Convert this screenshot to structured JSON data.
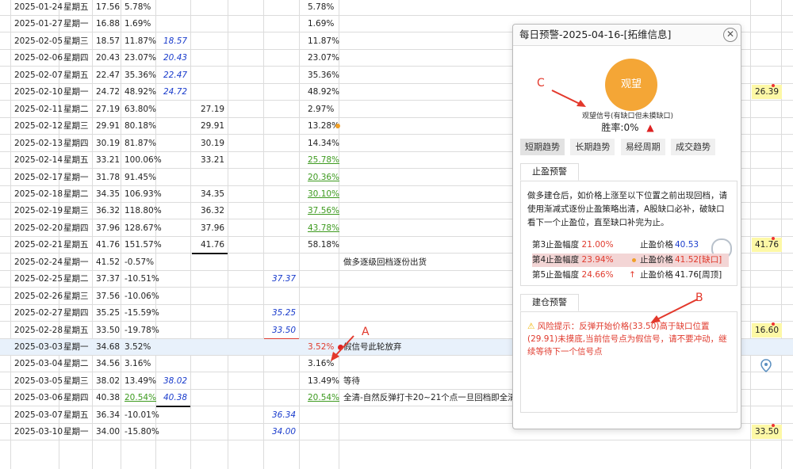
{
  "table": {
    "rows": [
      {
        "date": "2025-01-24",
        "weekday": "星期五",
        "price": "17.56",
        "pct": "5.78%",
        "pct_style": "",
        "blue": "",
        "blue_underline": false,
        "price2": "",
        "price2_underline": false,
        "blue2": "",
        "blue2_underline": false,
        "r": "5.78%",
        "r_style": "",
        "r_dot": "",
        "note": "",
        "yellow": "",
        "highlight": false
      },
      {
        "date": "2025-01-27",
        "weekday": "星期一",
        "price": "16.88",
        "pct": "1.69%",
        "pct_style": "",
        "blue": "",
        "blue_underline": false,
        "price2": "",
        "price2_underline": false,
        "blue2": "",
        "blue2_underline": false,
        "r": "1.69%",
        "r_style": "",
        "r_dot": "",
        "note": "",
        "yellow": "",
        "highlight": false
      },
      {
        "date": "2025-02-05",
        "weekday": "星期三",
        "price": "18.57",
        "pct": "11.87%",
        "pct_style": "",
        "blue": "18.57",
        "blue_underline": false,
        "price2": "",
        "price2_underline": false,
        "blue2": "",
        "blue2_underline": false,
        "r": "11.87%",
        "r_style": "",
        "r_dot": "",
        "note": "",
        "yellow": "",
        "highlight": false
      },
      {
        "date": "2025-02-06",
        "weekday": "星期四",
        "price": "20.43",
        "pct": "23.07%",
        "pct_style": "",
        "blue": "20.43",
        "blue_underline": false,
        "price2": "",
        "price2_underline": false,
        "blue2": "",
        "blue2_underline": false,
        "r": "23.07%",
        "r_style": "",
        "r_dot": "",
        "note": "",
        "yellow": "",
        "highlight": false
      },
      {
        "date": "2025-02-07",
        "weekday": "星期五",
        "price": "22.47",
        "pct": "35.36%",
        "pct_style": "",
        "blue": "22.47",
        "blue_underline": false,
        "price2": "",
        "price2_underline": false,
        "blue2": "",
        "blue2_underline": false,
        "r": "35.36%",
        "r_style": "",
        "r_dot": "",
        "note": "",
        "yellow": "",
        "highlight": false
      },
      {
        "date": "2025-02-10",
        "weekday": "星期一",
        "price": "24.72",
        "pct": "48.92%",
        "pct_style": "",
        "blue": "24.72",
        "blue_underline": false,
        "price2": "",
        "price2_underline": false,
        "blue2": "",
        "blue2_underline": false,
        "r": "48.92%",
        "r_style": "",
        "r_dot": "",
        "note": "",
        "yellow": "26.39",
        "highlight": false
      },
      {
        "date": "2025-02-11",
        "weekday": "星期二",
        "price": "27.19",
        "pct": "63.80%",
        "pct_style": "",
        "blue": "",
        "blue_underline": false,
        "price2": "27.19",
        "price2_underline": false,
        "blue2": "",
        "blue2_underline": false,
        "r": "2.97%",
        "r_style": "",
        "r_dot": "",
        "note": "",
        "yellow": "",
        "highlight": false
      },
      {
        "date": "2025-02-12",
        "weekday": "星期三",
        "price": "29.91",
        "pct": "80.18%",
        "pct_style": "",
        "blue": "",
        "blue_underline": false,
        "price2": "29.91",
        "price2_underline": false,
        "blue2": "",
        "blue2_underline": false,
        "r": "13.28%",
        "r_style": "",
        "r_dot": "orange",
        "note": "",
        "yellow": "",
        "highlight": false
      },
      {
        "date": "2025-02-13",
        "weekday": "星期四",
        "price": "30.19",
        "pct": "81.87%",
        "pct_style": "",
        "blue": "",
        "blue_underline": false,
        "price2": "30.19",
        "price2_underline": false,
        "blue2": "",
        "blue2_underline": false,
        "r": "14.34%",
        "r_style": "",
        "r_dot": "",
        "note": "",
        "yellow": "",
        "highlight": false
      },
      {
        "date": "2025-02-14",
        "weekday": "星期五",
        "price": "33.21",
        "pct": "100.06%",
        "pct_style": "",
        "blue": "",
        "blue_underline": false,
        "price2": "33.21",
        "price2_underline": false,
        "blue2": "",
        "blue2_underline": false,
        "r": "25.78%",
        "r_style": "green",
        "r_dot": "",
        "note": "",
        "yellow": "",
        "highlight": false
      },
      {
        "date": "2025-02-17",
        "weekday": "星期一",
        "price": "31.78",
        "pct": "91.45%",
        "pct_style": "",
        "blue": "",
        "blue_underline": false,
        "price2": "",
        "price2_underline": false,
        "blue2": "",
        "blue2_underline": false,
        "r": "20.36%",
        "r_style": "green",
        "r_dot": "",
        "note": "",
        "yellow": "",
        "highlight": false
      },
      {
        "date": "2025-02-18",
        "weekday": "星期二",
        "price": "34.35",
        "pct": "106.93%",
        "pct_style": "",
        "blue": "",
        "blue_underline": false,
        "price2": "34.35",
        "price2_underline": false,
        "blue2": "",
        "blue2_underline": false,
        "r": "30.10%",
        "r_style": "green",
        "r_dot": "",
        "note": "",
        "yellow": "",
        "highlight": false
      },
      {
        "date": "2025-02-19",
        "weekday": "星期三",
        "price": "36.32",
        "pct": "118.80%",
        "pct_style": "",
        "blue": "",
        "blue_underline": false,
        "price2": "36.32",
        "price2_underline": false,
        "blue2": "",
        "blue2_underline": false,
        "r": "37.56%",
        "r_style": "green",
        "r_dot": "",
        "note": "",
        "yellow": "",
        "highlight": false
      },
      {
        "date": "2025-02-20",
        "weekday": "星期四",
        "price": "37.96",
        "pct": "128.67%",
        "pct_style": "",
        "blue": "",
        "blue_underline": false,
        "price2": "37.96",
        "price2_underline": false,
        "blue2": "",
        "blue2_underline": false,
        "r": "43.78%",
        "r_style": "green",
        "r_dot": "",
        "note": "",
        "yellow": "",
        "highlight": false
      },
      {
        "date": "2025-02-21",
        "weekday": "星期五",
        "price": "41.76",
        "pct": "151.57%",
        "pct_style": "",
        "blue": "",
        "blue_underline": false,
        "price2": "41.76",
        "price2_underline": true,
        "blue2": "",
        "blue2_underline": false,
        "r": "58.18%",
        "r_style": "",
        "r_dot": "",
        "note": "",
        "yellow": "41.76",
        "highlight": false
      },
      {
        "date": "2025-02-24",
        "weekday": "星期一",
        "price": "41.52",
        "pct": "-0.57%",
        "pct_style": "",
        "blue": "",
        "blue_underline": false,
        "price2": "",
        "price2_underline": false,
        "blue2": "",
        "blue2_underline": false,
        "r": "",
        "r_style": "",
        "r_dot": "",
        "note": "做多逐级回档逐份出货",
        "yellow": "",
        "highlight": false
      },
      {
        "date": "2025-02-25",
        "weekday": "星期二",
        "price": "37.37",
        "pct": "-10.51%",
        "pct_style": "",
        "blue": "",
        "blue_underline": false,
        "price2": "",
        "price2_underline": false,
        "blue2": "37.37",
        "blue2_underline": false,
        "r": "",
        "r_style": "",
        "r_dot": "",
        "note": "",
        "yellow": "",
        "highlight": false
      },
      {
        "date": "2025-02-26",
        "weekday": "星期三",
        "price": "37.56",
        "pct": "-10.06%",
        "pct_style": "",
        "blue": "",
        "blue_underline": false,
        "price2": "",
        "price2_underline": false,
        "blue2": "",
        "blue2_underline": false,
        "r": "",
        "r_style": "",
        "r_dot": "",
        "note": "",
        "yellow": "",
        "highlight": false
      },
      {
        "date": "2025-02-27",
        "weekday": "星期四",
        "price": "35.25",
        "pct": "-15.59%",
        "pct_style": "",
        "blue": "",
        "blue_underline": false,
        "price2": "",
        "price2_underline": false,
        "blue2": "35.25",
        "blue2_underline": false,
        "r": "",
        "r_style": "",
        "r_dot": "",
        "note": "",
        "yellow": "",
        "highlight": false
      },
      {
        "date": "2025-02-28",
        "weekday": "星期五",
        "price": "33.50",
        "pct": "-19.78%",
        "pct_style": "",
        "blue": "",
        "blue_underline": false,
        "price2": "",
        "price2_underline": false,
        "blue2": "33.50",
        "blue2_underline": true,
        "r": "",
        "r_style": "",
        "r_dot": "",
        "note": "",
        "yellow": "16.60",
        "highlight": false
      },
      {
        "date": "2025-03-03",
        "weekday": "星期一",
        "price": "34.68",
        "pct": "3.52%",
        "pct_style": "",
        "blue": "",
        "blue_underline": false,
        "price2": "",
        "price2_underline": false,
        "blue2": "",
        "blue2_underline": false,
        "r": "3.52%",
        "r_style": "red",
        "r_dot": "red",
        "note": "假信号此轮放弃",
        "yellow": "",
        "highlight": true
      },
      {
        "date": "2025-03-04",
        "weekday": "星期二",
        "price": "34.56",
        "pct": "3.16%",
        "pct_style": "",
        "blue": "",
        "blue_underline": false,
        "price2": "",
        "price2_underline": false,
        "blue2": "",
        "blue2_underline": false,
        "r": "3.16%",
        "r_style": "",
        "r_dot": "",
        "note": "",
        "yellow": "",
        "highlight": false
      },
      {
        "date": "2025-03-05",
        "weekday": "星期三",
        "price": "38.02",
        "pct": "13.49%",
        "pct_style": "",
        "blue": "38.02",
        "blue_underline": false,
        "price2": "",
        "price2_underline": false,
        "blue2": "",
        "blue2_underline": false,
        "r": "13.49%",
        "r_style": "",
        "r_dot": "",
        "note": "等待",
        "yellow": "",
        "highlight": false
      },
      {
        "date": "2025-03-06",
        "weekday": "星期四",
        "price": "40.38",
        "pct": "20.54%",
        "pct_style": "green",
        "blue": "40.38",
        "blue_underline": true,
        "price2": "",
        "price2_underline": false,
        "blue2": "",
        "blue2_underline": false,
        "r": "20.54%",
        "r_style": "green",
        "r_dot": "",
        "note": "全清-自然反弹打卡20~21个点一旦回档即全清",
        "yellow": "",
        "highlight": false
      },
      {
        "date": "2025-03-07",
        "weekday": "星期五",
        "price": "36.34",
        "pct": "-10.01%",
        "pct_style": "",
        "blue": "",
        "blue_underline": false,
        "price2": "",
        "price2_underline": false,
        "blue2": "36.34",
        "blue2_underline": false,
        "r": "",
        "r_style": "",
        "r_dot": "",
        "note": "",
        "yellow": "",
        "highlight": false
      },
      {
        "date": "2025-03-10",
        "weekday": "星期一",
        "price": "34.00",
        "pct": "-15.80%",
        "pct_style": "",
        "blue": "",
        "blue_underline": false,
        "price2": "",
        "price2_underline": false,
        "blue2": "34.00",
        "blue2_underline": false,
        "r": "",
        "r_style": "",
        "r_dot": "",
        "note": "",
        "yellow": "33.50",
        "highlight": false
      }
    ]
  },
  "popup": {
    "title": "每日预警-2025-04-16-[拓维信息]",
    "close_icon": "close-icon",
    "signal_label": "观望",
    "signal_desc": "观望信号(有缺口但未摸缺口)",
    "win_rate": "胜率:0%",
    "tabs": [
      "短期趋势",
      "长期趋势",
      "易经周期",
      "成交趋势"
    ],
    "stop_profit": {
      "tab_label": "止盈预警",
      "desc": "做多建仓后，如价格上涨至以下位置之前出现回档，请使用渐减式逐份止盈策略出清，A股缺口必补，破缺口看下一个止盈位，直至缺口补完为止。",
      "rows": [
        {
          "level": "第3止盈幅度",
          "pct": "21.00%",
          "price_label": "止盈价格",
          "price": "40.53",
          "note": ""
        },
        {
          "level": "第4止盈幅度",
          "pct": "23.94%",
          "price_label": "止盈价格",
          "price": "41.52",
          "note": "[缺口]"
        },
        {
          "level": "第5止盈幅度",
          "pct": "24.66%",
          "price_label": "止盈价格",
          "price": "41.76",
          "note": "[周顶]"
        }
      ]
    },
    "build": {
      "tab_label": "建仓预警",
      "warning": "风险提示：反弹开始价格(33.50)高于缺口位置(29.91)未摸底,当前信号点为假信号，请不要冲动，继续等待下一个信号点"
    }
  },
  "annotations": {
    "a": "A",
    "b": "B",
    "c": "C"
  },
  "colors": {
    "accent_red": "#e03b2e",
    "signal_orange": "#f4a636",
    "highlight_yellow": "#fdf8a6",
    "row_highlight": "#e8f1fb"
  }
}
